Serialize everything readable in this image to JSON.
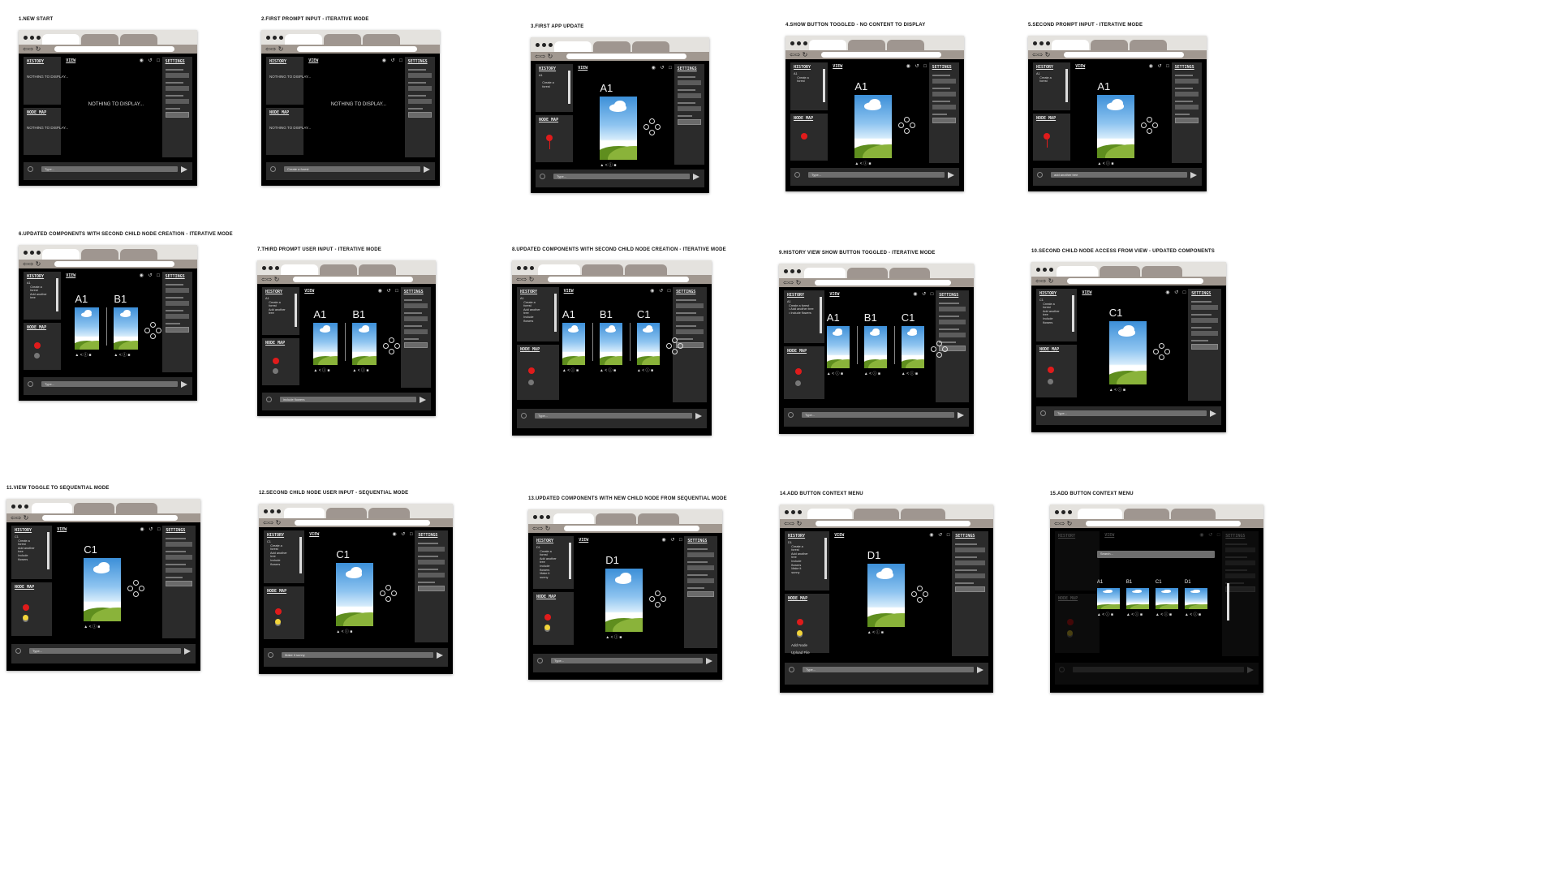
{
  "frames": [
    {
      "title": "1.NEW START",
      "empty": true,
      "view_message": "NOTHING TO DISPLAY...",
      "history_empty": "NOTHING TO DISPLAY...",
      "nodemap_empty": "NOTHING TO DISPLAY...",
      "prompt": "Type..."
    },
    {
      "title": "2.FIRST PROMPT INPUT - ITERATIVE MODE",
      "empty": true,
      "view_message": "NOTHING TO DISPLAY...",
      "history_empty": "NOTHING TO DISPLAY...",
      "nodemap_empty": "NOTHING TO DISPLAY...",
      "prompt": "Create a forest"
    },
    {
      "title": "3.FIRST APP UPDATE",
      "cards": [
        "A1"
      ],
      "history": "A1\n\n    Create a\n    forest",
      "prompt": "Type..."
    },
    {
      "title": "4.SHOW BUTTON TOGGLED - NO CONTENT TO DISPLAY",
      "cards": [
        "A1"
      ],
      "history": "A1\n    Create a\n    forest",
      "prompt": "Type..."
    },
    {
      "title": "5.SECOND PROMPT INPUT - ITERATIVE MODE",
      "cards": [
        "A1"
      ],
      "history": "A1\n    Create a\n    forest",
      "prompt": "add another tree"
    },
    {
      "title": "6.UPDATED COMPONENTS WITH SECOND CHILD NODE CREATION - ITERATIVE MODE",
      "cards": [
        "A1",
        "B1"
      ],
      "history": "A1\n    Create a\n    forest\n    Add another\n    tree",
      "prompt": "Type..."
    },
    {
      "title": "7.THIRD PROMPT USER INPUT - ITERATIVE MODE",
      "cards": [
        "A1",
        "B1"
      ],
      "history": "A1\n    Create a\n    forest\n    Add another\n    tree",
      "prompt": "include flowers"
    },
    {
      "title": "8.UPDATED COMPONENTS WITH SECOND CHILD NODE CREATION - ITERATIVE MODE",
      "cards": [
        "A1",
        "B1",
        "C1"
      ],
      "history": "A1\n    Create a\n    forest\n    Add another\n    tree\n    Include\n    flowers",
      "prompt": "Type..."
    },
    {
      "title": "9.HISTORY VIEW SHOW BUTTON TOGGLED - ITERATIVE MODE",
      "cards": [
        "A1",
        "B1",
        "C1"
      ],
      "history": "A1\n  Create a forest\n  • Add another tree\n  • Include flowers",
      "prompt": "Type..."
    },
    {
      "title": "10.SECOND CHILD NODE ACCESS FROM VIEW - UPDATED COMPONENTS",
      "cards": [
        "C1"
      ],
      "history": "C1\n    Create a\n    forest\n    Add another\n    tree\n    Include\n    flowers",
      "prompt": "Type..."
    },
    {
      "title": "11.VIEW TOGGLE TO SEQUENTIAL MODE",
      "cards": [
        "C1"
      ],
      "history": "C1\n    Create a\n    forest\n    Add another\n    tree\n    Include\n    flowers",
      "prompt": "Type..."
    },
    {
      "title": "12.SECOND CHILD NODE USER INPUT - SEQUENTIAL MODE",
      "cards": [
        "C1"
      ],
      "history": "C1\n    Create a\n    forest\n    Add another\n    tree\n    Include\n    flowers",
      "prompt": "Make it sunny"
    },
    {
      "title": "13.UPDATED COMPONENTS WITH NEW CHILD NODE FROM SEQUENTIAL MODE",
      "cards": [
        "D1"
      ],
      "history": "D1\n    Create a\n    forest\n    Add another\n    tree\n    Include\n    flowers\n    Make it\n    sunny",
      "prompt": "Type..."
    },
    {
      "title": "14.ADD BUTTON CONTEXT MENU",
      "cards": [
        "D1"
      ],
      "history": "D1\n    Create a\n    forest\n    Add another\n    tree\n    Include\n    flowers\n    Make it\n    sunny",
      "prompt": "Type...",
      "context": [
        "Add Node",
        "Upload File"
      ]
    },
    {
      "title": "15.ADD BUTTON CONTEXT MENU",
      "overlay": true,
      "cards": [
        "A1",
        "B1",
        "C1",
        "D1"
      ],
      "search": "Search...",
      "prompt": ""
    }
  ],
  "labels": {
    "history": "HISTORY",
    "view": "VIEW",
    "settings": "SETTINGS",
    "node_map": "NODE MAP",
    "view_icons": "◉ ↺ □",
    "card_tools": "▲ < ⓘ      ■"
  }
}
